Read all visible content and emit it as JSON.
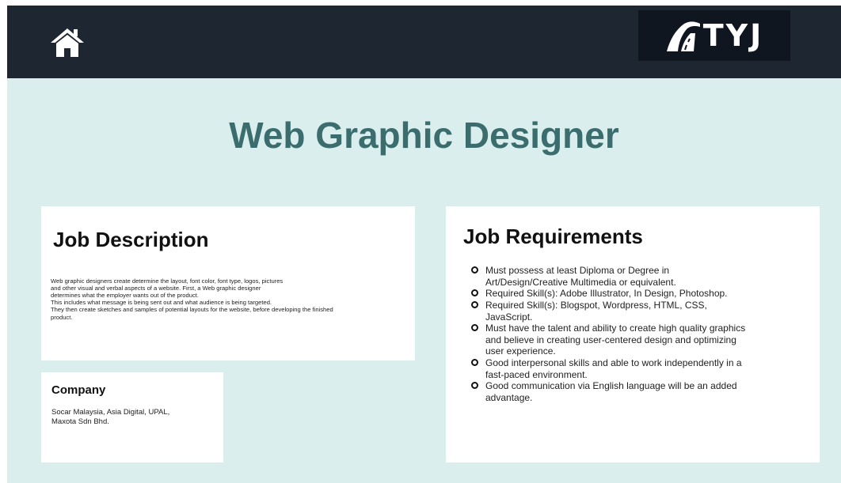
{
  "header": {
    "home_icon": "home-icon",
    "logo_text": "TYJ",
    "logo_icon": "road-icon"
  },
  "title": "Web Graphic Designer",
  "job_description": {
    "heading": "Job Description",
    "lines": [
      "Web graphic designers create determine the layout, font color, font type, logos, pictures",
      "and other visual and verbal aspects of a website. First, a Web graphic designer",
      "determines what the employer wants out of the product.",
      "This includes what message is being sent out and what audience is being targeted.",
      "They then create sketches and samples of potential layouts for the website, before developing the finished",
      "product."
    ]
  },
  "company": {
    "heading": "Company",
    "lines": [
      "Socar Malaysia, Asia Digital, UPAL,",
      "Maxota Sdn Bhd."
    ]
  },
  "job_requirements": {
    "heading": "Job Requirements",
    "items": [
      [
        "Must possess at least Diploma or Degree in",
        "Art/Design/Creative Multimedia or equivalent."
      ],
      [
        "Required Skill(s): Adobe Illustrator, In Design, Photoshop."
      ],
      [
        "Required Skill(s): Blogspot, Wordpress, HTML, CSS,",
        "JavaScript."
      ],
      [
        "Must have the talent and ability to create high quality graphics",
        "and believe in creating user-centered design and optimizing",
        "user experience."
      ],
      [
        "Good interpersonal skills and able to work independently in a",
        "fast-paced environment."
      ],
      [
        "Good communication via English language will be an added",
        "advantage."
      ]
    ]
  },
  "colors": {
    "header_bg": "#1e2632",
    "page_bg": "#dbeeee",
    "title": "#3b6d6e",
    "card_bg": "#ffffff"
  }
}
